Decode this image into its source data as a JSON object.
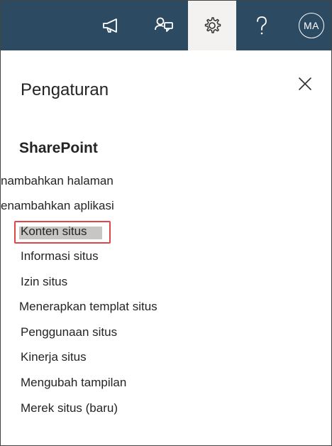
{
  "topbar": {
    "buttons": [
      {
        "icon": "megaphone-icon",
        "label": "Announcements"
      },
      {
        "icon": "chat-feedback-icon",
        "label": "Feedback"
      },
      {
        "icon": "gear-icon",
        "label": "Settings",
        "active": true
      },
      {
        "icon": "question-mark-icon",
        "label": "Help"
      }
    ],
    "avatar_initials": "MA",
    "colors": {
      "background": "#2d4a63",
      "active_tab": "#f3f2f1"
    }
  },
  "panel": {
    "title": "Pengaturan",
    "close_icon": "close-icon",
    "section_title": "SharePoint",
    "items": [
      {
        "label": "nambahkan halaman"
      },
      {
        "label": "enambahkan aplikasi"
      },
      {
        "label": "Konten situs",
        "highlighted": true
      },
      {
        "label": "Informasi situs"
      },
      {
        "label": "Izin situs"
      },
      {
        "label": "Menerapkan templat situs"
      },
      {
        "label": "Penggunaan situs"
      },
      {
        "label": "Kinerja situs"
      },
      {
        "label": "Mengubah tampilan"
      },
      {
        "label": "Merek situs (baru)"
      }
    ],
    "highlight_color": "#e0454a"
  }
}
